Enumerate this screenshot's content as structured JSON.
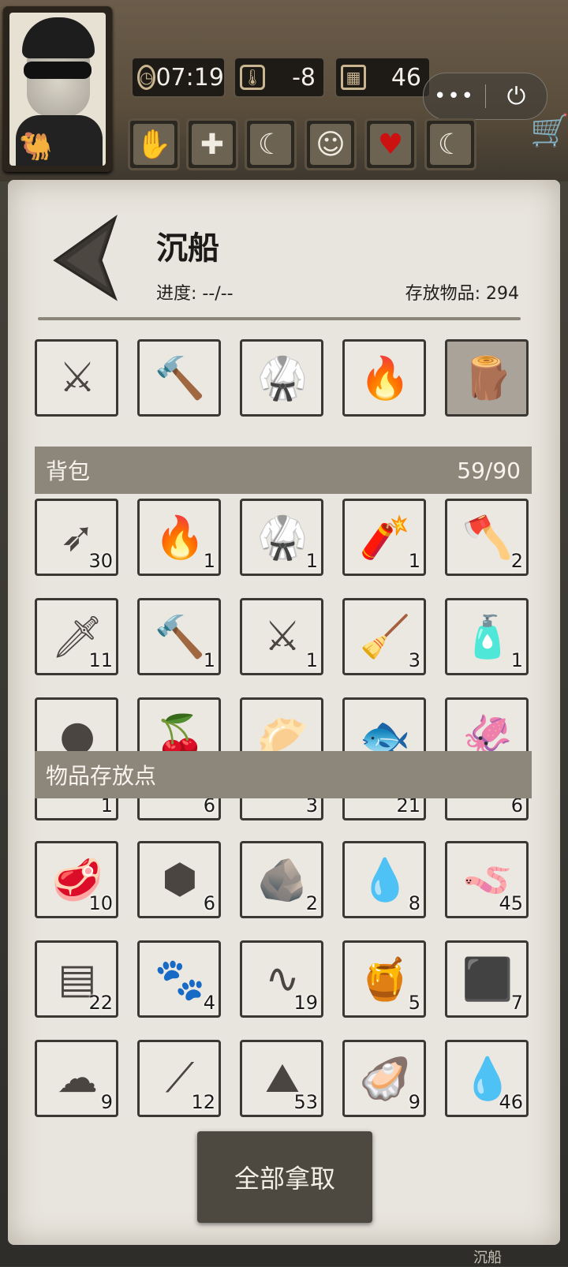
{
  "hud": {
    "time": "07:19",
    "temperature": "-8",
    "days": "46",
    "menu_dots": "•••",
    "status_icons": [
      "hand-icon",
      "health-cross-icon",
      "stomach-icon",
      "mind-icon",
      "heart-icon",
      "moon-icon"
    ]
  },
  "page": {
    "title": "沉船",
    "progress": "进度: --/--",
    "stored": "存放物品: 294"
  },
  "equipped": [
    {
      "icon": "crossbow-icon",
      "glyph": "⚔"
    },
    {
      "icon": "stone-hammer-icon",
      "glyph": "🔨"
    },
    {
      "icon": "chainmail-icon",
      "glyph": "🥋"
    },
    {
      "icon": "torch-icon",
      "glyph": "🔥"
    },
    {
      "icon": "log-bundle-icon",
      "glyph": "🪵"
    }
  ],
  "backpack": {
    "label": "背包",
    "capacity": "59/90",
    "items": [
      {
        "icon": "arrows-icon",
        "glyph": "➶",
        "count": "30"
      },
      {
        "icon": "torch-icon",
        "glyph": "🔥",
        "count": "1"
      },
      {
        "icon": "chainmail-icon",
        "glyph": "🥋",
        "count": "1"
      },
      {
        "icon": "dynamite-icon",
        "glyph": "🧨",
        "count": "1"
      },
      {
        "icon": "axe-icon",
        "glyph": "🪓",
        "count": "2"
      },
      {
        "icon": "knife-icon",
        "glyph": "🗡",
        "count": "11"
      },
      {
        "icon": "stone-hammer-icon",
        "glyph": "🔨",
        "count": "1"
      },
      {
        "icon": "crossbow-icon",
        "glyph": "⚔",
        "count": "1"
      },
      {
        "icon": "broom-icon",
        "glyph": "🧹",
        "count": "3"
      },
      {
        "icon": "bottle-icon",
        "glyph": "🧴",
        "count": "1"
      },
      {
        "icon": "bomb-icon",
        "glyph": "●",
        "count": ""
      },
      {
        "icon": "berries-icon",
        "glyph": "🍒",
        "count": ""
      },
      {
        "icon": "balls-plate-icon",
        "glyph": "🥟",
        "count": ""
      },
      {
        "icon": "fish-icon",
        "glyph": "🐟",
        "count": ""
      },
      {
        "icon": "squid-icon",
        "glyph": "🦑",
        "count": ""
      }
    ]
  },
  "storage": {
    "label": "物品存放点",
    "partial_counts": [
      "1",
      "6",
      "3",
      "21",
      "6"
    ],
    "items": [
      {
        "icon": "raw-meat-icon",
        "glyph": "🥩",
        "count": "10"
      },
      {
        "icon": "honeycomb-icon",
        "glyph": "⬢",
        "count": "6"
      },
      {
        "icon": "stone-icon",
        "glyph": "🪨",
        "count": "2"
      },
      {
        "icon": "oil-puddle-icon",
        "glyph": "💧",
        "count": "8"
      },
      {
        "icon": "worms-icon",
        "glyph": "🪱",
        "count": "45"
      },
      {
        "icon": "planks-icon",
        "glyph": "▤",
        "count": "22"
      },
      {
        "icon": "animal-hide-icon",
        "glyph": "🐾",
        "count": "4"
      },
      {
        "icon": "rope-icon",
        "glyph": "∿",
        "count": "19"
      },
      {
        "icon": "resin-icon",
        "glyph": "🍯",
        "count": "5"
      },
      {
        "icon": "coal-icon",
        "glyph": "⬛",
        "count": "7"
      },
      {
        "icon": "wool-icon",
        "glyph": "☁",
        "count": "9"
      },
      {
        "icon": "spears-icon",
        "glyph": "⟋",
        "count": "12"
      },
      {
        "icon": "salt-pile-icon",
        "glyph": "⛰",
        "count": "53"
      },
      {
        "icon": "pearl-shell-icon",
        "glyph": "🦪",
        "count": "9"
      },
      {
        "icon": "oil-stone-icon",
        "glyph": "💧",
        "count": "46"
      }
    ]
  },
  "actions": {
    "take_all": "全部拿取"
  },
  "footer": "沉船"
}
